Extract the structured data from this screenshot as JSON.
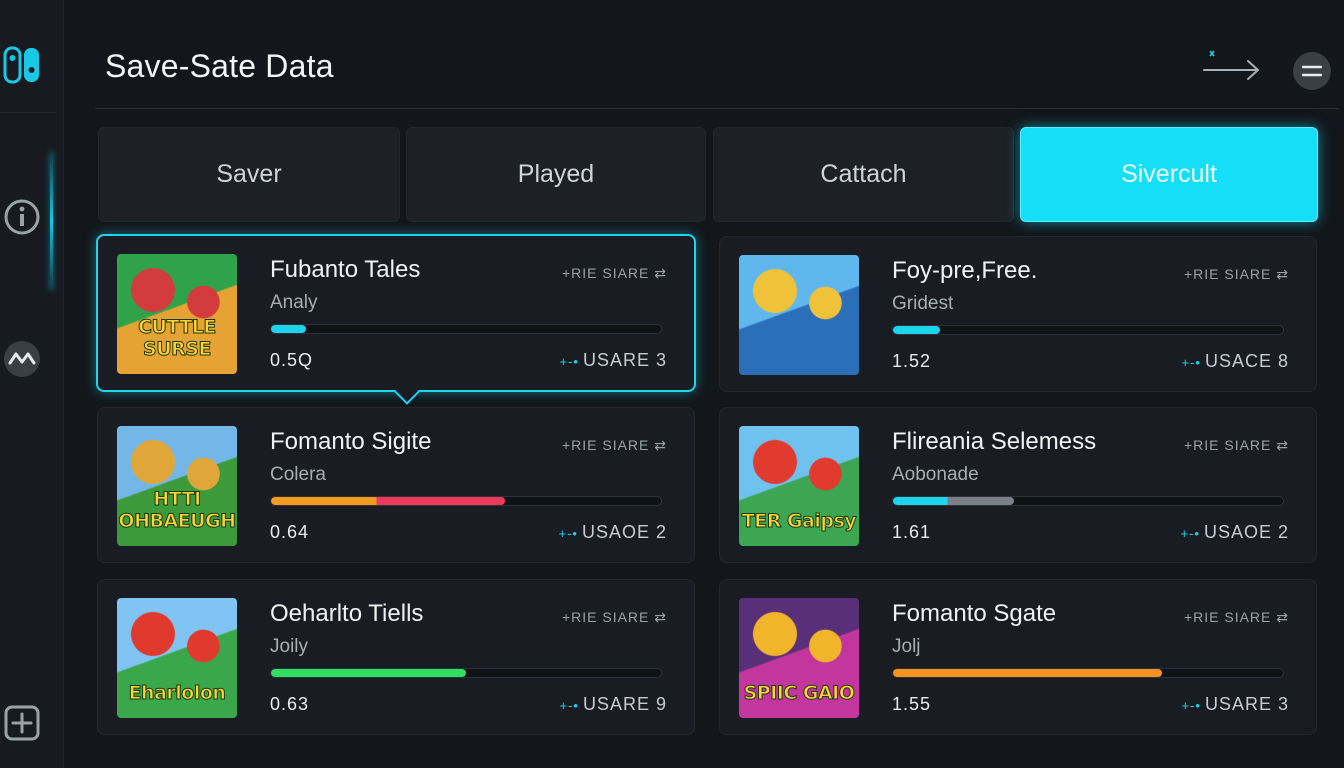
{
  "header": {
    "title": "Save-Sate Data"
  },
  "tabs": [
    {
      "label": "Saver",
      "active": false
    },
    {
      "label": "Played",
      "active": false
    },
    {
      "label": "Cattach",
      "active": false
    },
    {
      "label": "Sivercult",
      "active": true
    }
  ],
  "games": [
    {
      "title": "Fubanto Tales",
      "subtitle": "Analy",
      "tag": "+RIE SIARE ⇄",
      "value": "0.5Q",
      "usage_prefix": "+-•",
      "usage": "USARE 3",
      "progress": 0.09,
      "bar_colors": [
        "#1ed3ec",
        "#1ed3ec"
      ],
      "thumb_text": "CUTTLE SURSE",
      "thumb_colors": [
        "#2fa24a",
        "#e6a233",
        "#d23c3c"
      ],
      "selected": true
    },
    {
      "title": "Foy-pre,Free.",
      "subtitle": "Gridest",
      "tag": "+RIE SIARE ⇄",
      "value": "1.52",
      "usage_prefix": "+-•",
      "usage": "USACE 8",
      "progress": 0.12,
      "bar_colors": [
        "#1ed3ec",
        "#1ed3ec"
      ],
      "thumb_text": "",
      "thumb_colors": [
        "#5fb7ee",
        "#2a6fb8",
        "#f0c23a"
      ],
      "selected": false
    },
    {
      "title": "Fomanto Sigite",
      "subtitle": "Colera",
      "tag": "+RIE SIARE ⇄",
      "value": "0.64",
      "usage_prefix": "+-•",
      "usage": "USAOE 2",
      "progress": 0.6,
      "bar_colors": [
        "#f39a1f",
        "#ef3a5d"
      ],
      "thumb_text": "HTTI OHBAEUGH",
      "thumb_colors": [
        "#73b7e8",
        "#3d9a3a",
        "#e0a63a"
      ],
      "selected": false
    },
    {
      "title": "Flireania Selemess",
      "subtitle": "Aobonade",
      "tag": "+RIE SIARE ⇄",
      "value": "1.61",
      "usage_prefix": "+-•",
      "usage": "USAOE 2",
      "progress": 0.31,
      "bar_colors": [
        "#1ed3ec",
        "#7b8088"
      ],
      "thumb_text": "TER Gaipsy",
      "thumb_colors": [
        "#6fc2ee",
        "#3ca653",
        "#e13b30"
      ],
      "selected": false
    },
    {
      "title": "Oeharlto Tiells",
      "subtitle": "Joily",
      "tag": "+RIE SIARE ⇄",
      "value": "0.63",
      "usage_prefix": "+-•",
      "usage": "USARE 9",
      "progress": 0.5,
      "bar_colors": [
        "#2ee05d",
        "#2ee05d"
      ],
      "thumb_text": "Eharlolon",
      "thumb_colors": [
        "#7fc4f2",
        "#3aa84a",
        "#e03a2e"
      ],
      "selected": false
    },
    {
      "title": "Fomanto Sgate",
      "subtitle": "Jolj",
      "tag": "+RIE SIARE ⇄",
      "value": "1.55",
      "usage_prefix": "+-•",
      "usage": "USARE 3",
      "progress": 0.69,
      "bar_colors": [
        "#f7931e",
        "#f7931e"
      ],
      "thumb_text": "SPIIC GAIO",
      "thumb_colors": [
        "#5a2f7a",
        "#c2369d",
        "#f0b52a"
      ],
      "selected": false
    }
  ],
  "icons": {
    "logo": "console-logo-icon",
    "info": "info-icon",
    "community": "community-icon",
    "add": "add-icon",
    "arrow": "arrow-right-icon",
    "menu": "menu-icon"
  },
  "colors": {
    "accent": "#14dff7",
    "background": "#13161b",
    "card": "#191d23"
  }
}
